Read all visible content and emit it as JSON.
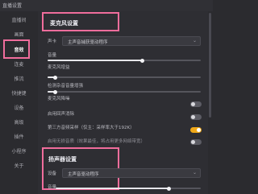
{
  "window": {
    "title": "直播设置"
  },
  "sidebar": {
    "items": [
      {
        "label": "直播间"
      },
      {
        "label": "画面"
      },
      {
        "label": "音效"
      },
      {
        "label": "连麦"
      },
      {
        "label": "推流"
      },
      {
        "label": "快捷键"
      },
      {
        "label": "设备"
      },
      {
        "label": "高级"
      },
      {
        "label": "插件"
      },
      {
        "label": "小程序"
      },
      {
        "label": "关于"
      }
    ],
    "active_index": 2
  },
  "mic_section": {
    "title": "麦克风设置",
    "device_label": "声卡",
    "device_value": "主声音捕获驱动程序",
    "volume_label": "音量",
    "volume_level": 0.62,
    "rows": [
      {
        "label": "麦克风增益"
      },
      {
        "label": "检测杂音音量增强"
      },
      {
        "label": "麦克风降噪"
      },
      {
        "label": "启用回声消除"
      },
      {
        "label": "第三方音频采样（仅主：采样率大于192K）"
      },
      {
        "label": "启用无损音质（效果最佳，将占用更多网络带宽）"
      }
    ],
    "gain_level": 0.05,
    "noise_level": 0.05,
    "toggles": {
      "denoise": false,
      "echo_cancel": false,
      "third_party_sampling": true,
      "lossless": false
    }
  },
  "speaker_section": {
    "title": "扬声器设置",
    "device_label": "设备",
    "device_value": "主声音驱动程序",
    "volume_label": "音量",
    "volume_level": 0.78
  },
  "colors": {
    "highlight": "#f06d9c",
    "toggle_on": "#f0a818"
  }
}
